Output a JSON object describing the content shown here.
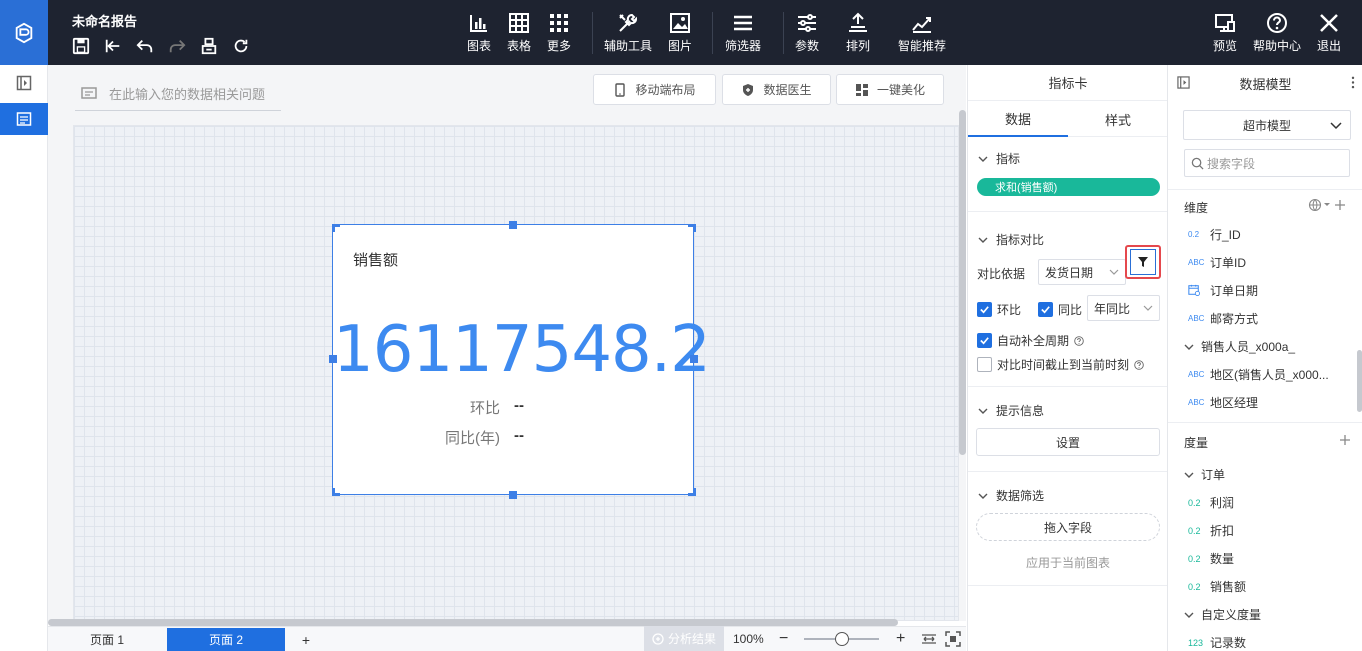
{
  "app": {
    "title": "未命名报告"
  },
  "toolbar": {
    "chart": "图表",
    "table": "表格",
    "more": "更多",
    "aux": "辅助工具",
    "image": "图片",
    "filter": "筛选器",
    "param": "参数",
    "sort": "排列",
    "smart": "智能推荐",
    "preview": "预览",
    "help": "帮助中心",
    "exit": "退出"
  },
  "canvas": {
    "ask_placeholder": "在此输入您的数据相关问题",
    "mobile_layout": "移动端布局",
    "data_doctor": "数据医生",
    "beautify": "一键美化"
  },
  "card": {
    "title": "销售额",
    "value": "16117548.2",
    "mom_label": "环比",
    "mom_value": "--",
    "yoy_label": "同比(年)",
    "yoy_value": "--"
  },
  "bottom": {
    "page1": "页面 1",
    "page2": "页面 2",
    "add": "+",
    "analysis": "分析结果",
    "zoom": "100%",
    "minus": "−",
    "plus": "+"
  },
  "panel": {
    "title": "指标卡",
    "tab_data": "数据",
    "tab_style": "样式",
    "metric_section": "指标",
    "metric_pill": "求和(销售额)",
    "compare_section": "指标对比",
    "compare_basis_label": "对比依据",
    "compare_basis_value": "发货日期",
    "mom": "环比",
    "yoy": "同比",
    "yoy_type": "年同比",
    "auto_fill": "自动补全周期",
    "cutoff": "对比时间截止到当前时刻",
    "tip_section": "提示信息",
    "tip_button": "设置",
    "filter_section": "数据筛选",
    "drag_field": "拖入字段",
    "apply_current": "应用于当前图表"
  },
  "model": {
    "title": "数据模型",
    "model_name": "超市模型",
    "search_placeholder": "搜索字段",
    "dimension": "维度",
    "measure": "度量",
    "dims": [
      {
        "type": "0.2",
        "label": "行_ID"
      },
      {
        "type": "ABC",
        "label": "订单ID"
      },
      {
        "type": "cal",
        "label": "订单日期"
      },
      {
        "type": "ABC",
        "label": "邮寄方式"
      }
    ],
    "dim_group": "销售人员_x000a_",
    "dim_group_items": [
      {
        "type": "ABC",
        "label": "地区(销售人员_x000..."
      },
      {
        "type": "ABC",
        "label": "地区经理"
      }
    ],
    "measure_group": "订单",
    "measures": [
      {
        "type": "0.2",
        "label": "利润"
      },
      {
        "type": "0.2",
        "label": "折扣"
      },
      {
        "type": "0.2",
        "label": "数量"
      },
      {
        "type": "0.2",
        "label": "销售额"
      }
    ],
    "custom_group": "自定义度量",
    "custom_items": [
      {
        "type": "123",
        "label": "记录数"
      }
    ]
  },
  "colors": {
    "accent": "#1f6fe0",
    "number": "#3d8af0",
    "pill": "#19b89a",
    "topbar": "#1e2330",
    "highlight": "#e5484d"
  }
}
